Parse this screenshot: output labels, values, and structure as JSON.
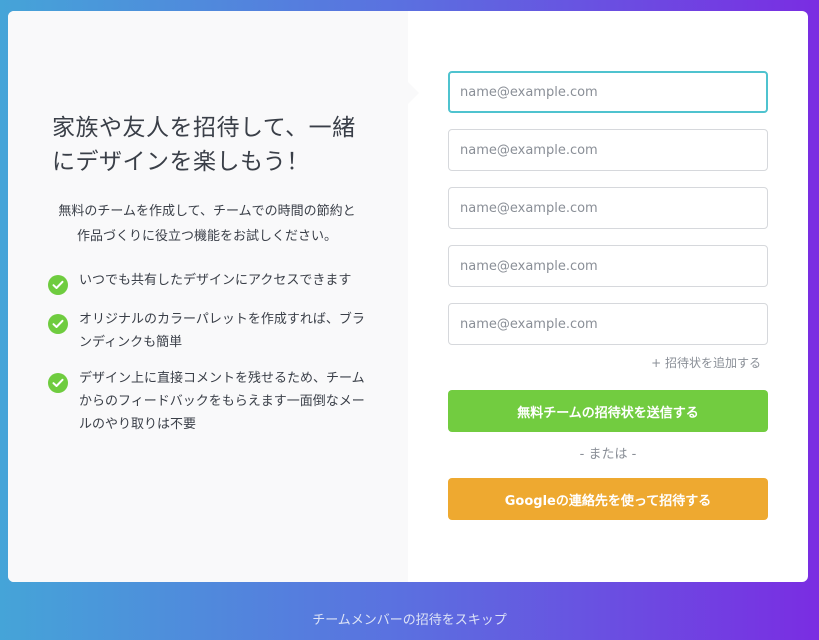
{
  "left": {
    "headline": "家族や友人を招待して、一緒にデザインを楽しもう！",
    "subtext": "無料のチームを作成して、チームでの時間の節約と作品づくりに役立つ機能をお試しください。",
    "features": [
      {
        "icon": "check-circle-icon",
        "text": "いつでも共有したデザインにアクセスできます"
      },
      {
        "icon": "check-circle-icon",
        "text": "オリジナルのカラーパレットを作成すれば、ブランディンクも簡単"
      },
      {
        "icon": "check-circle-icon",
        "text": "デザイン上に直接コメントを残せるため、チームからのフィードバックをもらえます一面倒なメールのやり取りは不要"
      }
    ]
  },
  "form": {
    "emails": [
      {
        "placeholder": "name@example.com",
        "value": ""
      },
      {
        "placeholder": "name@example.com",
        "value": ""
      },
      {
        "placeholder": "name@example.com",
        "value": ""
      },
      {
        "placeholder": "name@example.com",
        "value": ""
      },
      {
        "placeholder": "name@example.com",
        "value": ""
      }
    ],
    "add_invite_label": "+ 招待状を追加する",
    "send_button_label": "無料チームの招待状を送信する",
    "or_label": "- または -",
    "google_button_label": "Googleの連絡先を使って招待する"
  },
  "skip_label": "チームメンバーの招待をスキップ",
  "colors": {
    "check": "#6fcc3f",
    "send_button": "#72cc40",
    "google_button": "#eea930",
    "focus_border": "#4fc3cf"
  }
}
